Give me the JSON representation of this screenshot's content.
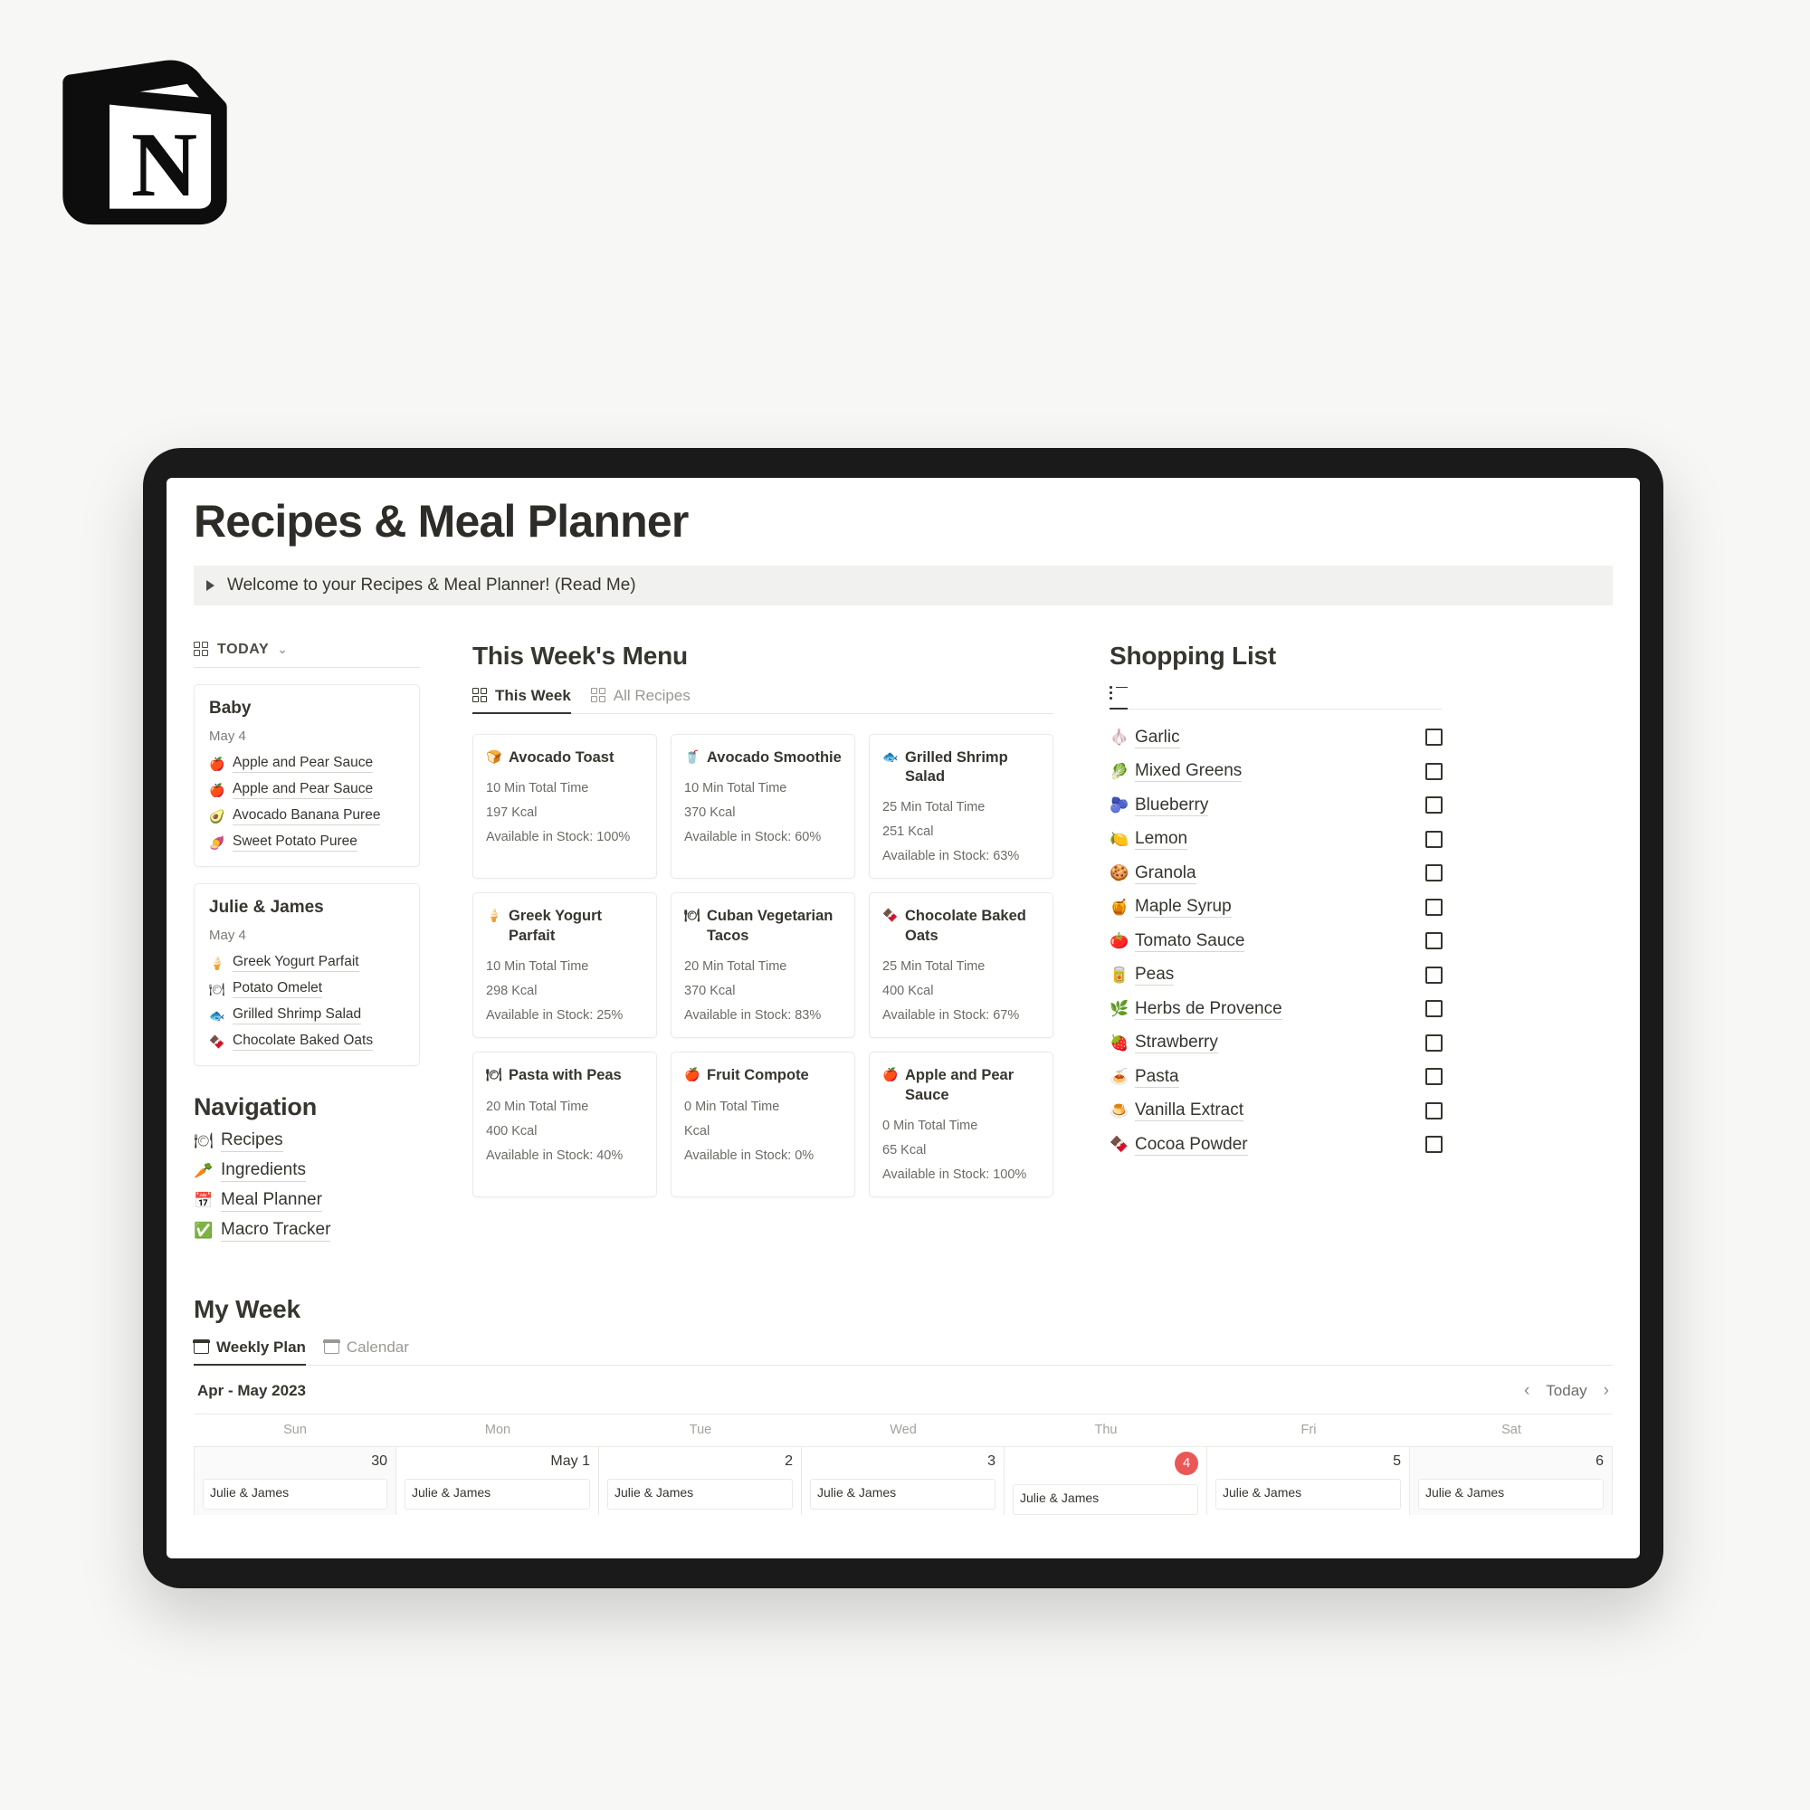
{
  "brand": {
    "logo_letter": "N",
    "logo_name": "notion-logo"
  },
  "page": {
    "title": "Recipes & Meal Planner",
    "callout": "Welcome to your Recipes & Meal Planner! (Read Me)"
  },
  "today_view": {
    "label": "TODAY",
    "cards": [
      {
        "name": "Baby",
        "date": "May 4",
        "meals": [
          {
            "icon": "🍎",
            "label": "Apple and Pear Sauce"
          },
          {
            "icon": "🍎",
            "label": "Apple and Pear Sauce"
          },
          {
            "icon": "🥑",
            "label": "Avocado Banana Puree"
          },
          {
            "icon": "🍠",
            "label": "Sweet Potato Puree"
          }
        ]
      },
      {
        "name": "Julie & James",
        "date": "May 4",
        "meals": [
          {
            "icon": "🍦",
            "label": "Greek Yogurt Parfait"
          },
          {
            "icon": "🍽",
            "label": "Potato Omelet"
          },
          {
            "icon": "🐟",
            "label": "Grilled Shrimp Salad"
          },
          {
            "icon": "🍫",
            "label": "Chocolate Baked Oats"
          }
        ]
      }
    ]
  },
  "navigation": {
    "heading": "Navigation",
    "items": [
      {
        "icon": "🍽",
        "label": "Recipes"
      },
      {
        "icon": "🥕",
        "label": "Ingredients"
      },
      {
        "icon": "📅",
        "label": "Meal Planner"
      },
      {
        "icon": "✅",
        "label": "Macro Tracker"
      }
    ]
  },
  "menu": {
    "heading": "This Week's Menu",
    "tabs": [
      {
        "label": "This Week",
        "active": true
      },
      {
        "label": "All Recipes",
        "active": false
      }
    ],
    "recipes": [
      {
        "icon": "🍞",
        "name": "Avocado Toast",
        "time": "10 Min Total Time",
        "kcal": "197 Kcal",
        "stock": "Available in Stock: 100%"
      },
      {
        "icon": "🥤",
        "name": "Avocado Smoothie",
        "time": "10 Min Total Time",
        "kcal": "370 Kcal",
        "stock": "Available in Stock: 60%"
      },
      {
        "icon": "🐟",
        "name": "Grilled Shrimp Salad",
        "time": "25 Min Total Time",
        "kcal": "251 Kcal",
        "stock": "Available in Stock: 63%"
      },
      {
        "icon": "🍦",
        "name": "Greek Yogurt Parfait",
        "time": "10 Min Total Time",
        "kcal": "298 Kcal",
        "stock": "Available in Stock: 25%"
      },
      {
        "icon": "🍽",
        "name": "Cuban Vegetarian Tacos",
        "time": "20 Min Total Time",
        "kcal": "370 Kcal",
        "stock": "Available in Stock: 83%"
      },
      {
        "icon": "🍫",
        "name": "Chocolate Baked Oats",
        "time": "25 Min Total Time",
        "kcal": "400 Kcal",
        "stock": "Available in Stock: 67%"
      },
      {
        "icon": "🍽",
        "name": "Pasta with Peas",
        "time": "20 Min Total Time",
        "kcal": "400 Kcal",
        "stock": "Available in Stock: 40%"
      },
      {
        "icon": "🍎",
        "name": "Fruit Compote",
        "time": "0 Min Total Time",
        "kcal": "Kcal",
        "stock": "Available in Stock: 0%"
      },
      {
        "icon": "🍎",
        "name": "Apple and Pear Sauce",
        "time": "0 Min Total Time",
        "kcal": "65 Kcal",
        "stock": "Available in Stock: 100%"
      }
    ]
  },
  "shopping": {
    "heading": "Shopping List",
    "view_icon": "list-view-icon",
    "items": [
      {
        "emoji": "🧄",
        "name": "Garlic",
        "checked": false
      },
      {
        "emoji": "🥬",
        "name": "Mixed Greens",
        "checked": false
      },
      {
        "emoji": "🫐",
        "name": "Blueberry",
        "checked": false
      },
      {
        "emoji": "🍋",
        "name": "Lemon",
        "checked": false
      },
      {
        "emoji": "🍪",
        "name": "Granola",
        "checked": false
      },
      {
        "emoji": "🍯",
        "name": "Maple Syrup",
        "checked": false
      },
      {
        "emoji": "🍅",
        "name": "Tomato Sauce",
        "checked": false
      },
      {
        "emoji": "🥫",
        "name": "Peas",
        "checked": false
      },
      {
        "emoji": "🌿",
        "name": "Herbs de Provence",
        "checked": false
      },
      {
        "emoji": "🍓",
        "name": "Strawberry",
        "checked": false
      },
      {
        "emoji": "🍝",
        "name": "Pasta",
        "checked": false
      },
      {
        "emoji": "🍮",
        "name": "Vanilla Extract",
        "checked": false
      },
      {
        "emoji": "🍫",
        "name": "Cocoa Powder",
        "checked": false
      }
    ]
  },
  "my_week": {
    "heading": "My Week",
    "tabs": [
      {
        "label": "Weekly Plan",
        "active": true
      },
      {
        "label": "Calendar",
        "active": false
      }
    ],
    "range": "Apr - May 2023",
    "today_button": "Today",
    "prev_icon": "‹",
    "next_icon": "›",
    "today_color": "#eb5757",
    "day_names": [
      "Sun",
      "Mon",
      "Tue",
      "Wed",
      "Thu",
      "Fri",
      "Sat"
    ],
    "days": [
      {
        "num": "30",
        "today": false,
        "weekend": true,
        "event": "Julie & James"
      },
      {
        "num": "May 1",
        "today": false,
        "weekend": false,
        "event": "Julie & James"
      },
      {
        "num": "2",
        "today": false,
        "weekend": false,
        "event": "Julie & James"
      },
      {
        "num": "3",
        "today": false,
        "weekend": false,
        "event": "Julie & James"
      },
      {
        "num": "4",
        "today": true,
        "weekend": false,
        "event": "Julie & James"
      },
      {
        "num": "5",
        "today": false,
        "weekend": false,
        "event": "Julie & James"
      },
      {
        "num": "6",
        "today": false,
        "weekend": true,
        "event": "Julie & James"
      }
    ]
  }
}
